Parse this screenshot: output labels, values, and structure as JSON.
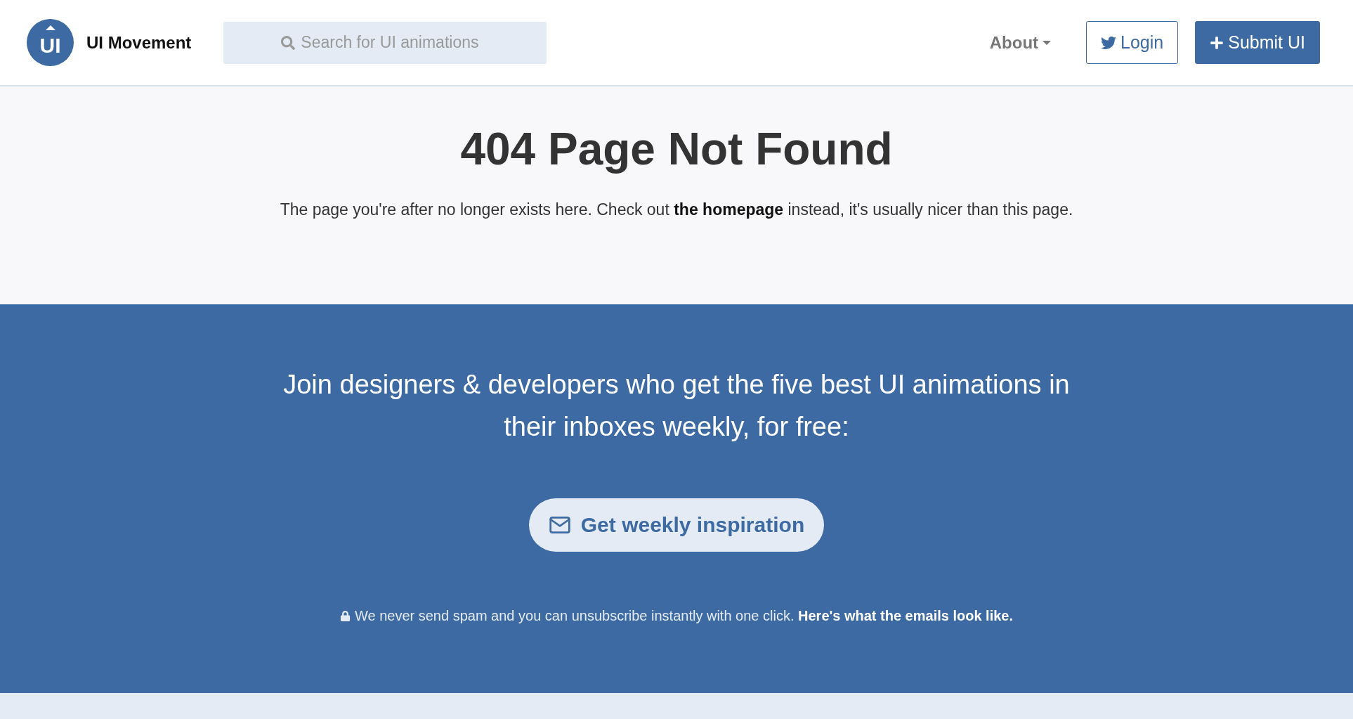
{
  "header": {
    "logo_mark": "UI",
    "brand": "UI Movement",
    "search": {
      "placeholder": "Search for UI animations"
    },
    "nav": {
      "about": "About",
      "login": "Login",
      "submit": "Submit UI"
    }
  },
  "error": {
    "title": "404 Page Not Found",
    "text_before": "The page you're after no longer exists here. Check out ",
    "link": "the homepage",
    "text_after": " instead, it's usually nicer than this page."
  },
  "newsletter": {
    "heading": "Join designers & developers who get the five best UI animations in their inboxes weekly, for free:",
    "button": "Get weekly inspiration",
    "note": "We never send spam and you can unsubscribe instantly with one click. ",
    "note_link": "Here's what the emails look like."
  }
}
